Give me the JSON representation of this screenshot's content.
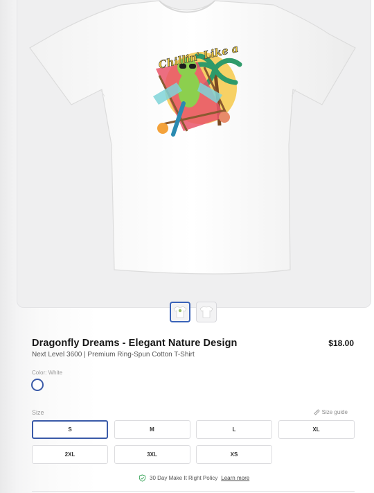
{
  "product": {
    "title": "Dragonfly Dreams - Elegant Nature Design",
    "subtitle": "Next Level 3600 | Premium Ring-Spun Cotton T-Shirt",
    "price": "$18.00",
    "image_print_text": "Chillin' Like a"
  },
  "gallery": {
    "thumbnails": [
      {
        "name": "front",
        "selected": true
      },
      {
        "name": "back",
        "selected": false
      }
    ]
  },
  "color": {
    "label": "Color: White",
    "selected": "White",
    "swatch_hex": "#ffffff"
  },
  "size": {
    "label": "Size",
    "guide_label": "Size guide",
    "options": [
      "S",
      "M",
      "L",
      "XL",
      "2XL",
      "3XL",
      "XS"
    ],
    "selected": "S"
  },
  "policy": {
    "text": "30 Day Make It Right Policy",
    "link": "Learn more"
  },
  "colors": {
    "accent": "#3a5aa8",
    "policy_icon": "#3aa55a"
  },
  "icons": {
    "size_guide": "ruler-icon",
    "policy": "shield-check-icon"
  }
}
